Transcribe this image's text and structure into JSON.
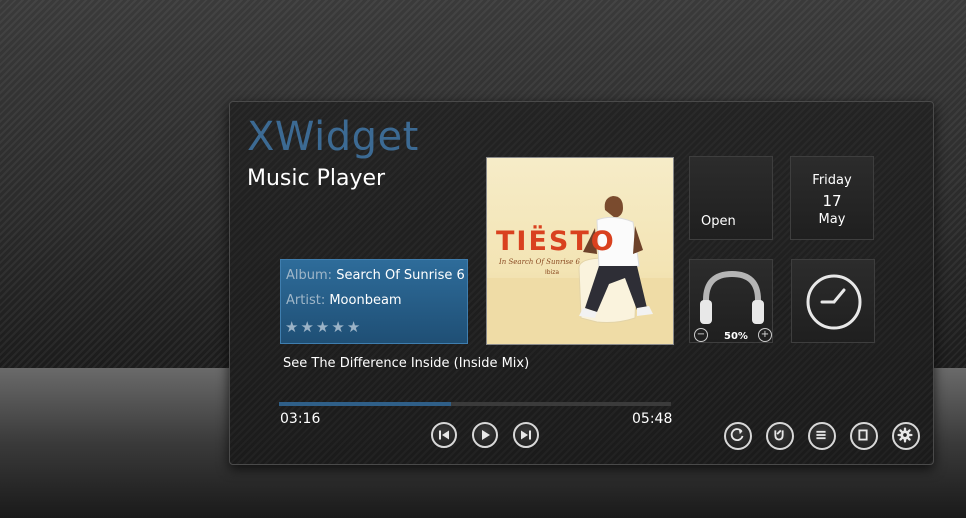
{
  "app": {
    "brand": "XWidget",
    "title": "Music Player"
  },
  "track": {
    "album_label": "Album:",
    "album": "Search Of Sunrise 6",
    "artist_label": "Artist:",
    "artist": "Moonbeam",
    "rating": 0,
    "rating_max": 5,
    "title": "See The Difference Inside (Inside Mix)"
  },
  "playback": {
    "elapsed": "03:16",
    "duration": "05:48",
    "progress": 0.44
  },
  "tiles": {
    "open_label": "Open",
    "date_weekday": "Friday",
    "date_day": "17",
    "date_month": "May",
    "volume": "50%"
  },
  "album_art": {
    "logo_text": "TIËSTO",
    "line1": "In Search Of Sunrise 6",
    "line2": "Ibiza"
  },
  "colors": {
    "accent": "#2f5f88",
    "brand": "#3c6a93"
  }
}
